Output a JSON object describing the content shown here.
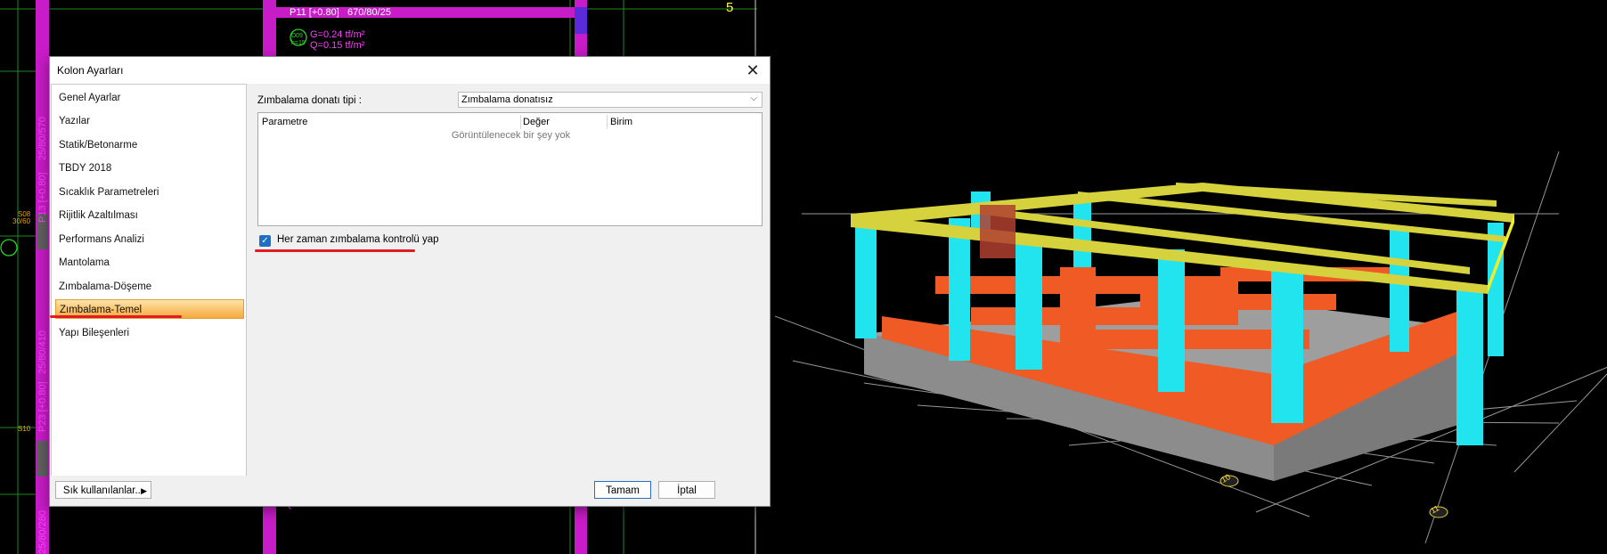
{
  "window": {
    "title": "Kolon Ayarları"
  },
  "nav": {
    "items": [
      {
        "label": "Genel Ayarlar"
      },
      {
        "label": "Yazılar"
      },
      {
        "label": "Statik/Betonarme"
      },
      {
        "label": "TBDY 2018"
      },
      {
        "label": "Sıcaklık Parametreleri"
      },
      {
        "label": "Rijitlik Azaltılması"
      },
      {
        "label": "Performans Analizi"
      },
      {
        "label": "Mantolama"
      },
      {
        "label": "Zımbalama-Döşeme"
      },
      {
        "label": "Zımbalama-Temel",
        "selected": true
      },
      {
        "label": "Yapı Bileşenleri"
      }
    ]
  },
  "content": {
    "type_label": "Zımbalama donatı tipi :",
    "type_value": "Zımbalama donatısız",
    "table": {
      "columns": [
        "Parametre",
        "Değer",
        "Birim"
      ],
      "empty_message": "Görüntülenecek bir şey yok"
    },
    "checkbox": {
      "label": "Her zaman zımbalama kontrolü yap",
      "checked": true
    }
  },
  "footer": {
    "frequent_label": "Sık kullanılanlar...",
    "ok_label": "Tamam",
    "cancel_label": "İptal"
  },
  "cad": {
    "beam_label": "P11 [+0.80]",
    "beam_dims": "670/80/25",
    "load_g": "G=0.24 tf/m²",
    "load_q": "Q=0.15 tf/m²",
    "slab_tag_1": "D09",
    "slab_tag_2": "h=15",
    "axis_number": "5",
    "col_label_1": "25/80/570",
    "col_label_2": "P13 [+0.80]",
    "col_label_3": "25/80/410",
    "col_label_4": "P23 [+0.80]",
    "col_label_5": "25/80/280",
    "side_tag_1": "S08",
    "side_tag_2": "30/60",
    "side_tag_3": "S10",
    "bottom_load": "Q=0.15 tf/m²"
  },
  "view3d": {
    "axis_labels": [
      "10",
      "11"
    ]
  },
  "colors": {
    "accent_red": "#e01b24",
    "selection_orange": "#f6a93e",
    "checkbox_blue": "#1f6fc6",
    "cad_magenta": "#ff40ff"
  },
  "icons": {
    "close": "close-icon",
    "submenu_arrow": "chevron-right-icon",
    "dropdown": "chevron-down-icon",
    "check": "checkmark-icon"
  }
}
